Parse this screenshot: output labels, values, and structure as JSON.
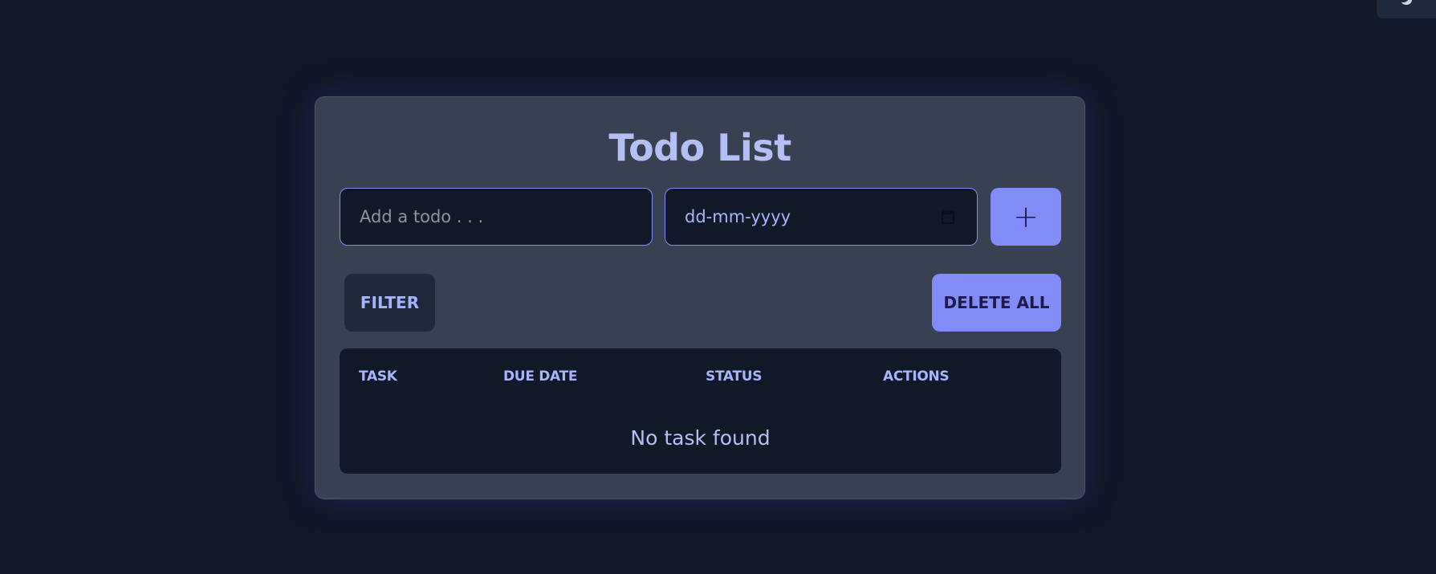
{
  "app": {
    "title": "Todo List"
  },
  "form": {
    "todo_placeholder": "Add a todo . . .",
    "date_placeholder": "dd-mm-yyyy",
    "add_label": "+"
  },
  "toolbar": {
    "filter_label": "FILTER",
    "delete_all_label": "DELETE ALL"
  },
  "table": {
    "headers": [
      "TASK",
      "DUE DATE",
      "STATUS",
      "ACTIONS"
    ],
    "empty_message": "No task found"
  },
  "icons": {
    "theme_toggle": "moon-icon",
    "date_picker": "calendar-icon"
  },
  "colors": {
    "background": "#111827",
    "card": "#374151",
    "accent": "#818cf8",
    "text": "#a5b4fc"
  }
}
